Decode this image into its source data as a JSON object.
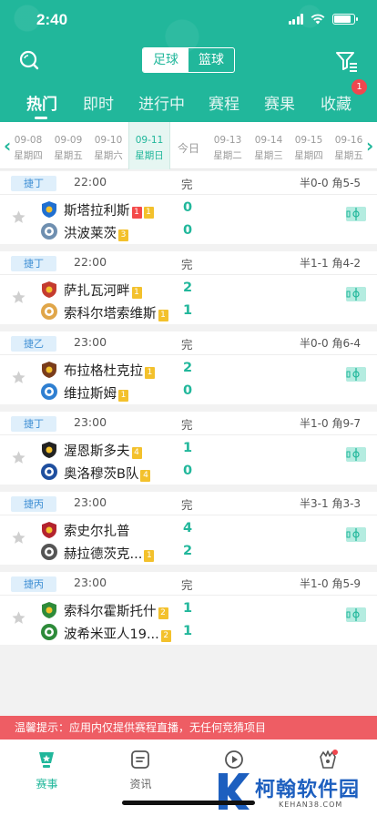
{
  "status_bar": {
    "time": "2:40"
  },
  "header": {
    "sport_tabs": [
      "足球",
      "篮球"
    ],
    "tabs": [
      "热门",
      "即时",
      "进行中",
      "赛程",
      "赛果",
      "收藏"
    ],
    "favorites_badge": "1"
  },
  "dates": [
    {
      "date": "09-08",
      "weekday": "星期四"
    },
    {
      "date": "09-09",
      "weekday": "星期五"
    },
    {
      "date": "09-10",
      "weekday": "星期六"
    },
    {
      "date": "09-11",
      "weekday": "星期日"
    },
    {
      "date": "今日",
      "weekday": ""
    },
    {
      "date": "09-13",
      "weekday": "星期二"
    },
    {
      "date": "09-14",
      "weekday": "星期三"
    },
    {
      "date": "09-15",
      "weekday": "星期四"
    },
    {
      "date": "09-16",
      "weekday": "星期五"
    }
  ],
  "matches": [
    {
      "league": "捷丁",
      "time": "22:00",
      "status": "完",
      "half": "半0-0",
      "corner": "角5-5",
      "home": {
        "name": "斯塔拉利斯",
        "score": "0",
        "cards": [
          {
            "type": "red",
            "n": "1"
          },
          {
            "type": "yel",
            "n": "1"
          }
        ]
      },
      "away": {
        "name": "洪波莱茨",
        "score": "0",
        "cards": [
          {
            "type": "yel",
            "n": "3"
          }
        ]
      }
    },
    {
      "league": "捷丁",
      "time": "22:00",
      "status": "完",
      "half": "半1-1",
      "corner": "角4-2",
      "home": {
        "name": "萨扎瓦河畔",
        "score": "2",
        "cards": [
          {
            "type": "yel",
            "n": "1"
          }
        ]
      },
      "away": {
        "name": "索科尔塔索维斯",
        "score": "1",
        "cards": [
          {
            "type": "yel",
            "n": "1"
          }
        ]
      }
    },
    {
      "league": "捷乙",
      "time": "23:00",
      "status": "完",
      "half": "半0-0",
      "corner": "角6-4",
      "home": {
        "name": "布拉格杜克拉",
        "score": "2",
        "cards": [
          {
            "type": "yel",
            "n": "1"
          }
        ]
      },
      "away": {
        "name": "维拉斯姆",
        "score": "0",
        "cards": [
          {
            "type": "yel",
            "n": "1"
          }
        ]
      }
    },
    {
      "league": "捷丁",
      "time": "23:00",
      "status": "完",
      "half": "半1-0",
      "corner": "角9-7",
      "home": {
        "name": "渥恩斯多夫",
        "score": "1",
        "cards": [
          {
            "type": "yel",
            "n": "4"
          }
        ]
      },
      "away": {
        "name": "奥洛穆茨B队",
        "score": "0",
        "cards": [
          {
            "type": "yel",
            "n": "4"
          }
        ]
      }
    },
    {
      "league": "捷丙",
      "time": "23:00",
      "status": "完",
      "half": "半3-1",
      "corner": "角3-3",
      "home": {
        "name": "索史尔扎普",
        "score": "4",
        "cards": []
      },
      "away": {
        "name": "赫拉德茨克...",
        "score": "2",
        "cards": [
          {
            "type": "yel",
            "n": "1"
          }
        ]
      }
    },
    {
      "league": "捷丙",
      "time": "23:00",
      "status": "完",
      "half": "半1-0",
      "corner": "角5-9",
      "home": {
        "name": "索科尔霍斯托什",
        "score": "1",
        "cards": [
          {
            "type": "yel",
            "n": "2"
          }
        ]
      },
      "away": {
        "name": "波希米亚人19...",
        "score": "1",
        "cards": [
          {
            "type": "yel",
            "n": "2"
          }
        ]
      }
    }
  ],
  "notice": "温馨提示：应用内仅提供赛程直播，无任何竞猜项目",
  "bottom_nav": [
    "赛事",
    "资讯",
    "",
    ""
  ],
  "watermark": {
    "text": "柯翰软件园",
    "url": "KEHAN38.COM"
  },
  "colors": {
    "primary": "#21b79b",
    "score": "#21b79b",
    "league_bg": "#dfeffb",
    "notice_bg": "#ee5d64"
  }
}
